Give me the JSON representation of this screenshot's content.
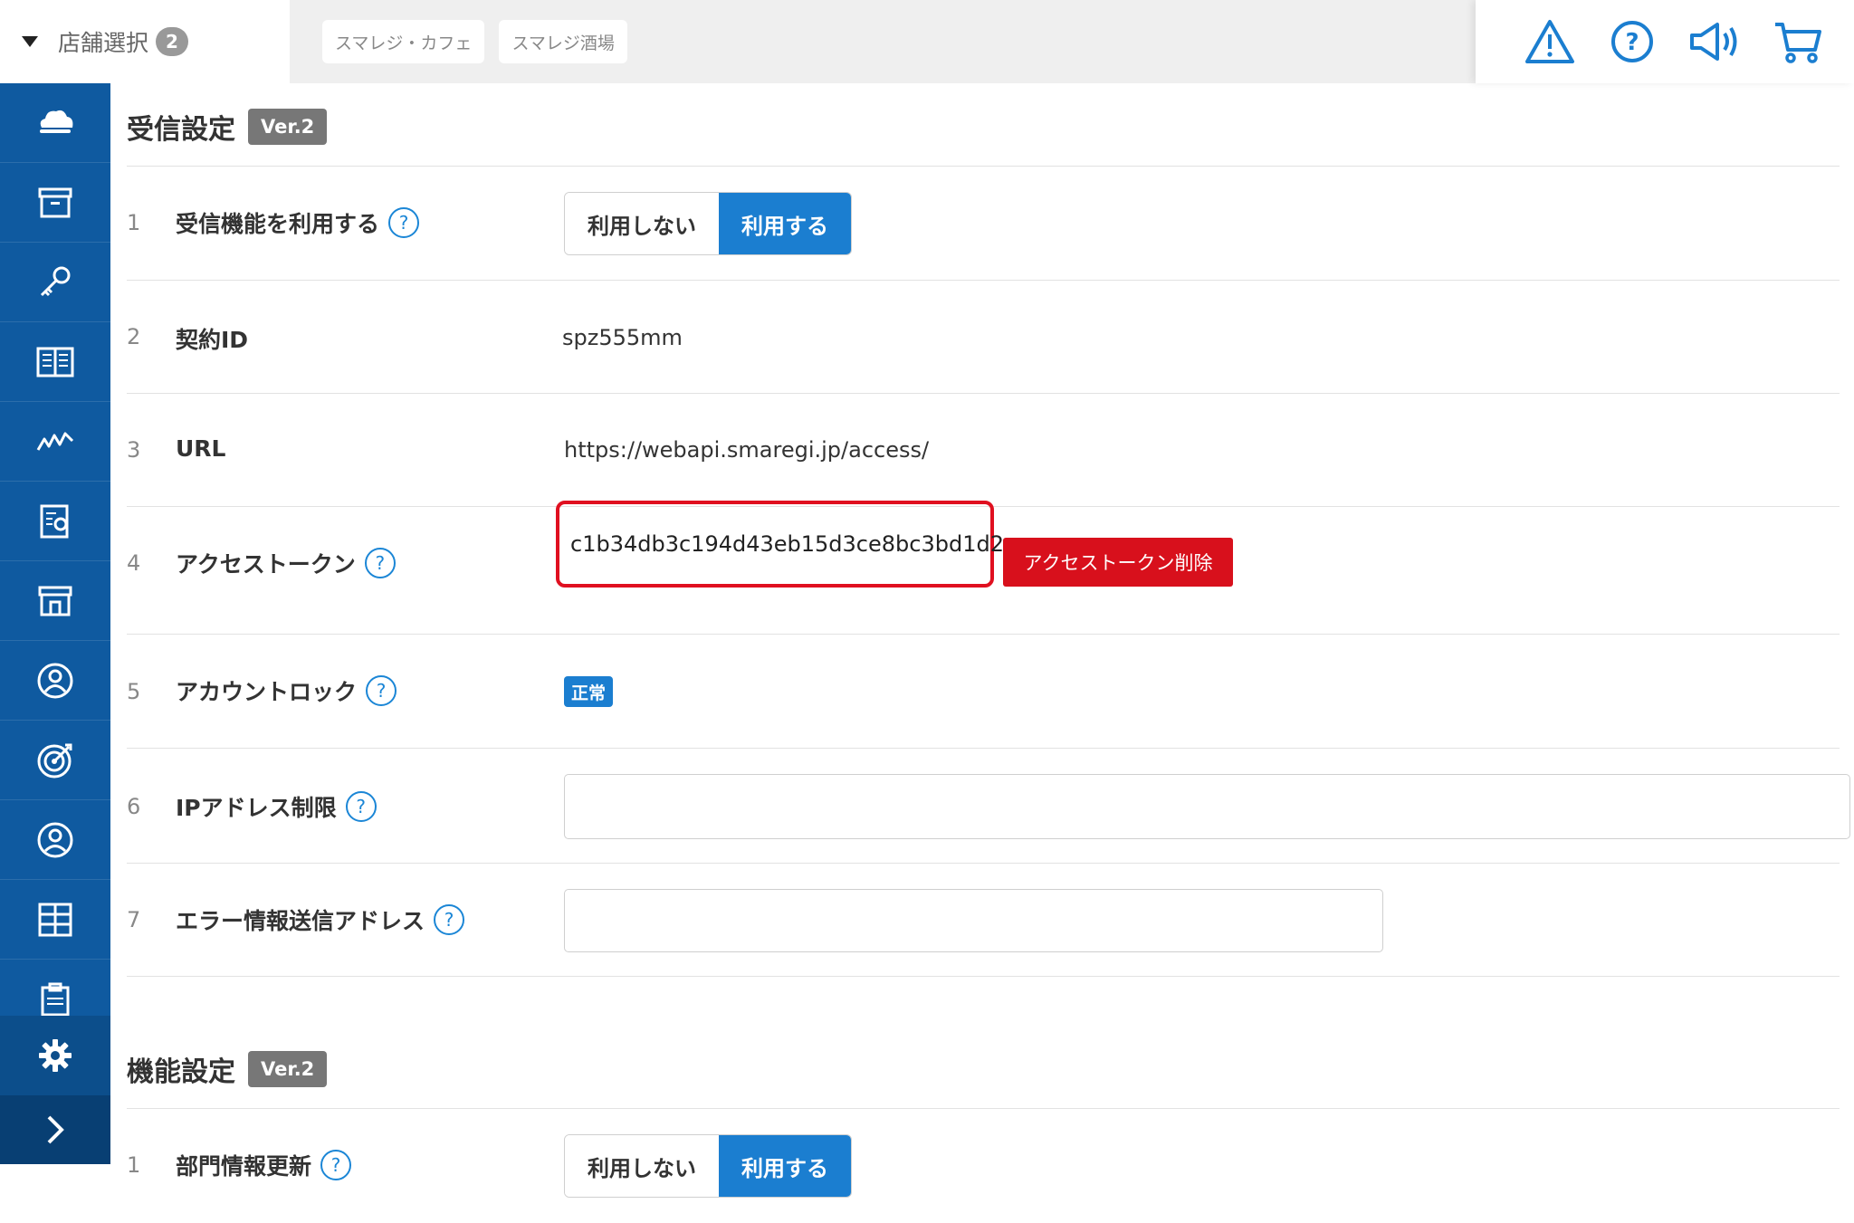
{
  "header": {
    "store_select_label": "店舗選択",
    "store_count": "2",
    "store_tabs": [
      "スマレジ・カフェ",
      "スマレジ酒場"
    ],
    "icons": [
      "warning-icon",
      "help-icon",
      "megaphone-icon",
      "cart-icon"
    ]
  },
  "sidebar": {
    "items": [
      "cloud-register-icon",
      "archive-icon",
      "key-icon",
      "book-icon",
      "chart-icon",
      "report-icon",
      "store-icon",
      "customer-icon",
      "target-icon",
      "staff-icon",
      "grid-icon",
      "clipboard-icon"
    ],
    "settings_icon": "gear-icon",
    "expand_icon": "chevron-right-icon"
  },
  "receive_settings": {
    "title": "受信設定",
    "version": "Ver.2",
    "rows": [
      {
        "num": "1",
        "label": "受信機能を利用する",
        "off_label": "利用しない",
        "on_label": "利用する",
        "selected": "on"
      },
      {
        "num": "2",
        "label": "契約ID",
        "value": "spz555mm"
      },
      {
        "num": "3",
        "label": "URL",
        "value": "https://webapi.smaregi.jp/access/"
      },
      {
        "num": "4",
        "label": "アクセストークン",
        "value": "c1b34db3c194d43eb15d3ce8bc3bd1d2",
        "delete_label": "アクセストークン削除"
      },
      {
        "num": "5",
        "label": "アカウントロック",
        "status": "正常"
      },
      {
        "num": "6",
        "label": "IPアドレス制限",
        "value": ""
      },
      {
        "num": "7",
        "label": "エラー情報送信アドレス",
        "value": ""
      }
    ]
  },
  "function_settings": {
    "title": "機能設定",
    "version": "Ver.2",
    "rows": [
      {
        "num": "1",
        "label": "部門情報更新",
        "off_label": "利用しない",
        "on_label": "利用する"
      }
    ]
  },
  "help_mark": "?",
  "colors": {
    "sidebar": "#0f5aa0",
    "accent": "#1b7ed0",
    "danger": "#d8101c"
  }
}
